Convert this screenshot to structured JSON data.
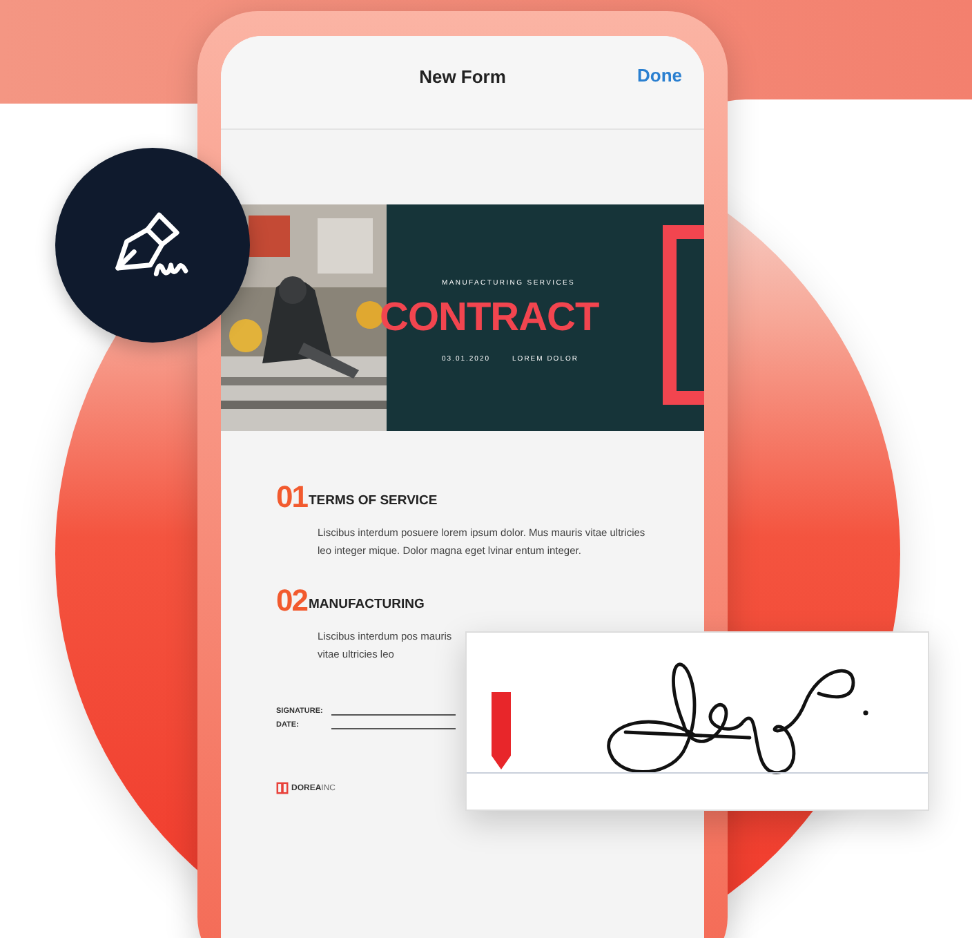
{
  "header": {
    "title": "New Form",
    "action": "Done"
  },
  "banner": {
    "kind": "picture",
    "tagline": "MANUFACTURING SERVICES",
    "title": "CONTRACT",
    "date": "03.01.2020",
    "author": "LOREM DOLOR"
  },
  "sections": [
    {
      "number": "01",
      "heading": "TERMS OF SERVICE",
      "body": "Liscibus interdum posuere lorem ipsum dolor. Mus mauris vitae ultricies leo integer mique. Dolor magna eget lvinar entum integer."
    },
    {
      "number": "02",
      "heading": "MANUFACTURING",
      "body": "Liscibus interdum pos mauris vitae ultricies leo"
    }
  ],
  "fields": [
    {
      "label": "SIGNATURE:"
    },
    {
      "label": "DATE:"
    }
  ],
  "footer": {
    "brand": "DOREA",
    "brand_suffix": "INC"
  }
}
